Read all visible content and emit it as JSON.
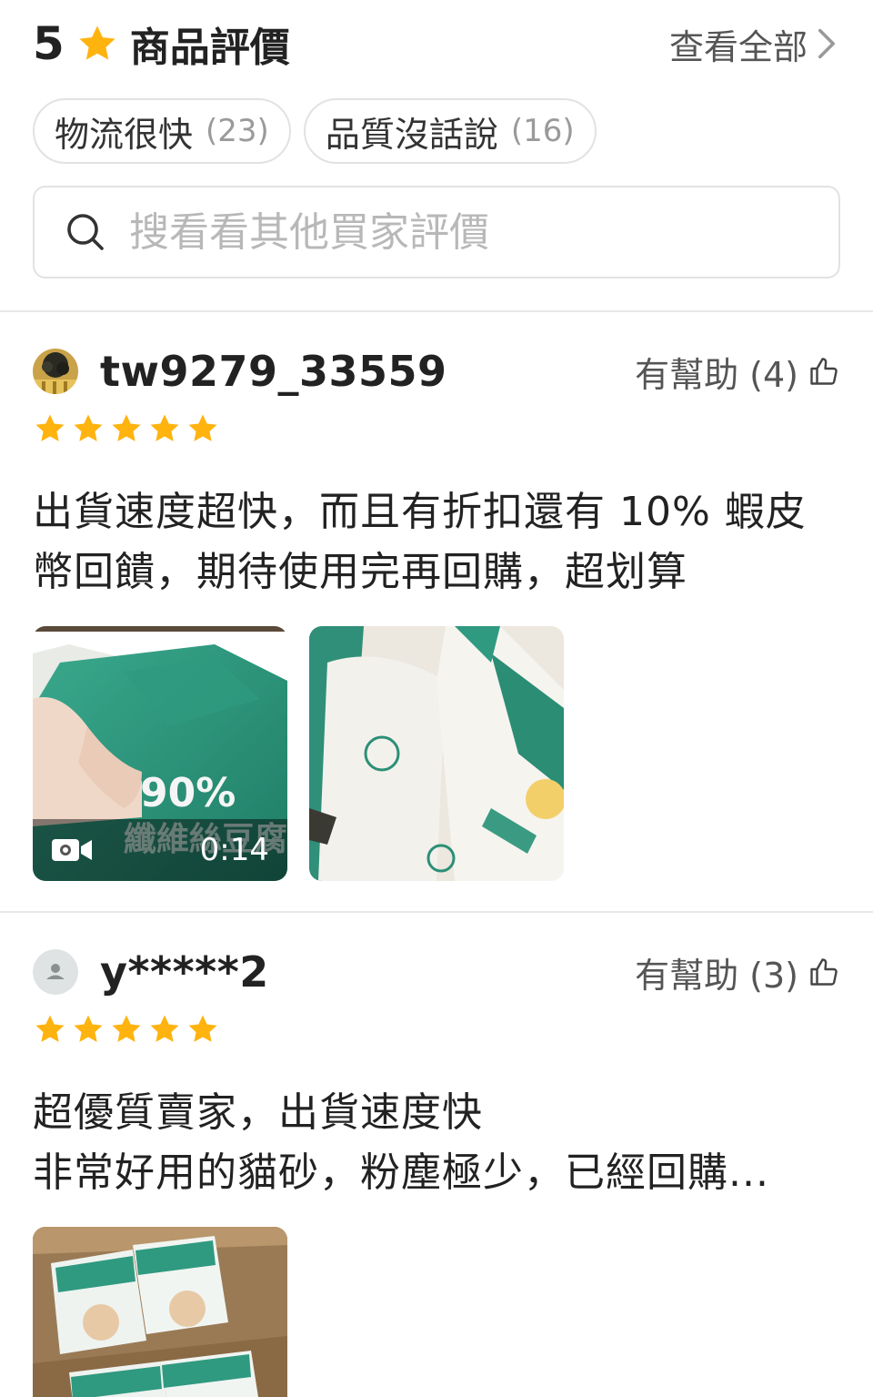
{
  "header": {
    "rating": "5",
    "title": "商品評價",
    "view_all": "查看全部"
  },
  "chips": [
    {
      "label": "物流很快",
      "count": "(23)"
    },
    {
      "label": "品質沒話說",
      "count": "(16)"
    }
  ],
  "search": {
    "placeholder": "搜看看其他買家評價"
  },
  "reviews": [
    {
      "username": "tw9279_33559",
      "helpful": "有幫助 (4)",
      "stars": 5,
      "text_lines": [
        "出貨速度超快，而且有折扣還有 10% 蝦皮",
        "幣回饋，期待使用完再回購，超划算"
      ],
      "media": [
        {
          "type": "video",
          "duration": "0:14",
          "overlay_text_1": "90%",
          "overlay_text_2": "纖維絲豆腐"
        },
        {
          "type": "image"
        }
      ]
    },
    {
      "username": "y*****2",
      "helpful": "有幫助 (3)",
      "stars": 5,
      "text_lines": [
        "超優質賣家，出貨速度快",
        "非常好用的貓砂，粉塵極少，已經回購..."
      ],
      "media": [
        {
          "type": "image"
        }
      ]
    }
  ],
  "colors": {
    "star": "#ffb30f",
    "chip_border": "#e2e2e2",
    "text_primary": "#222222",
    "text_secondary": "#555555",
    "placeholder": "#b8b8b8"
  },
  "icons": [
    "star-icon",
    "chevron-right-icon",
    "search-icon",
    "thumbs-up-icon",
    "video-camera-icon",
    "default-avatar-icon"
  ]
}
